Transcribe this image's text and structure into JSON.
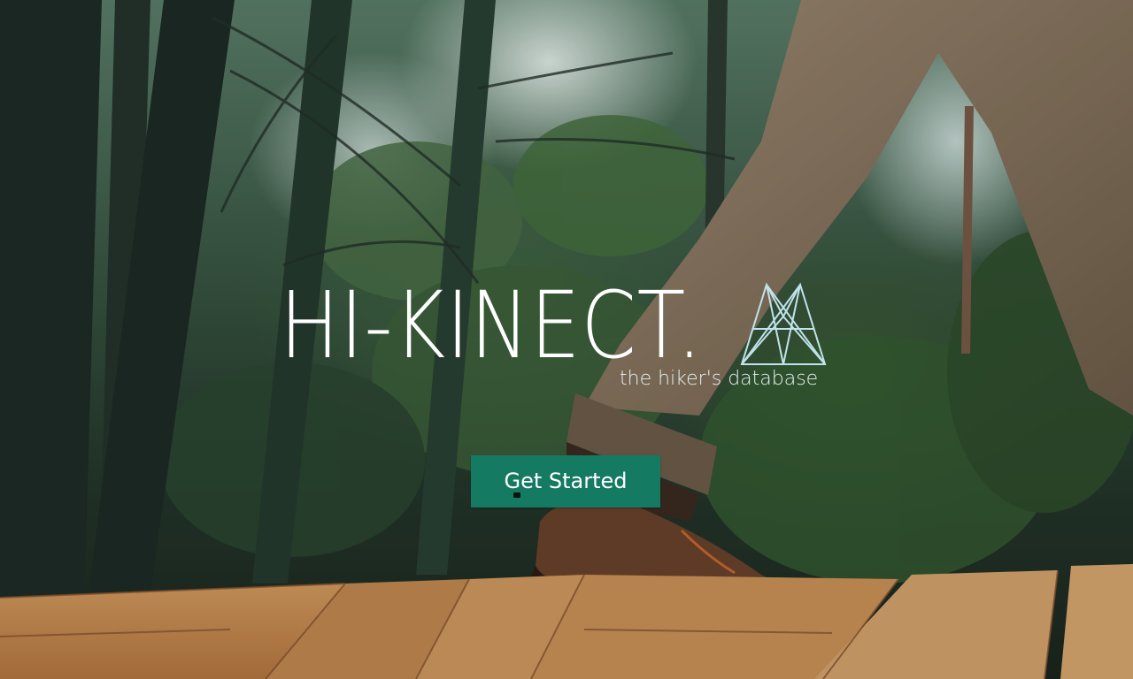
{
  "hero": {
    "logo_text": "HI-KINECT.",
    "tagline": "the hiker's database",
    "cta_label": "Get Started"
  },
  "icons": {
    "logo_mark": "mountain-peaks-icon"
  },
  "colors": {
    "cta_background": "#157a62",
    "logo_text": "#ffffff",
    "logo_mark": "#bfe3ec"
  }
}
